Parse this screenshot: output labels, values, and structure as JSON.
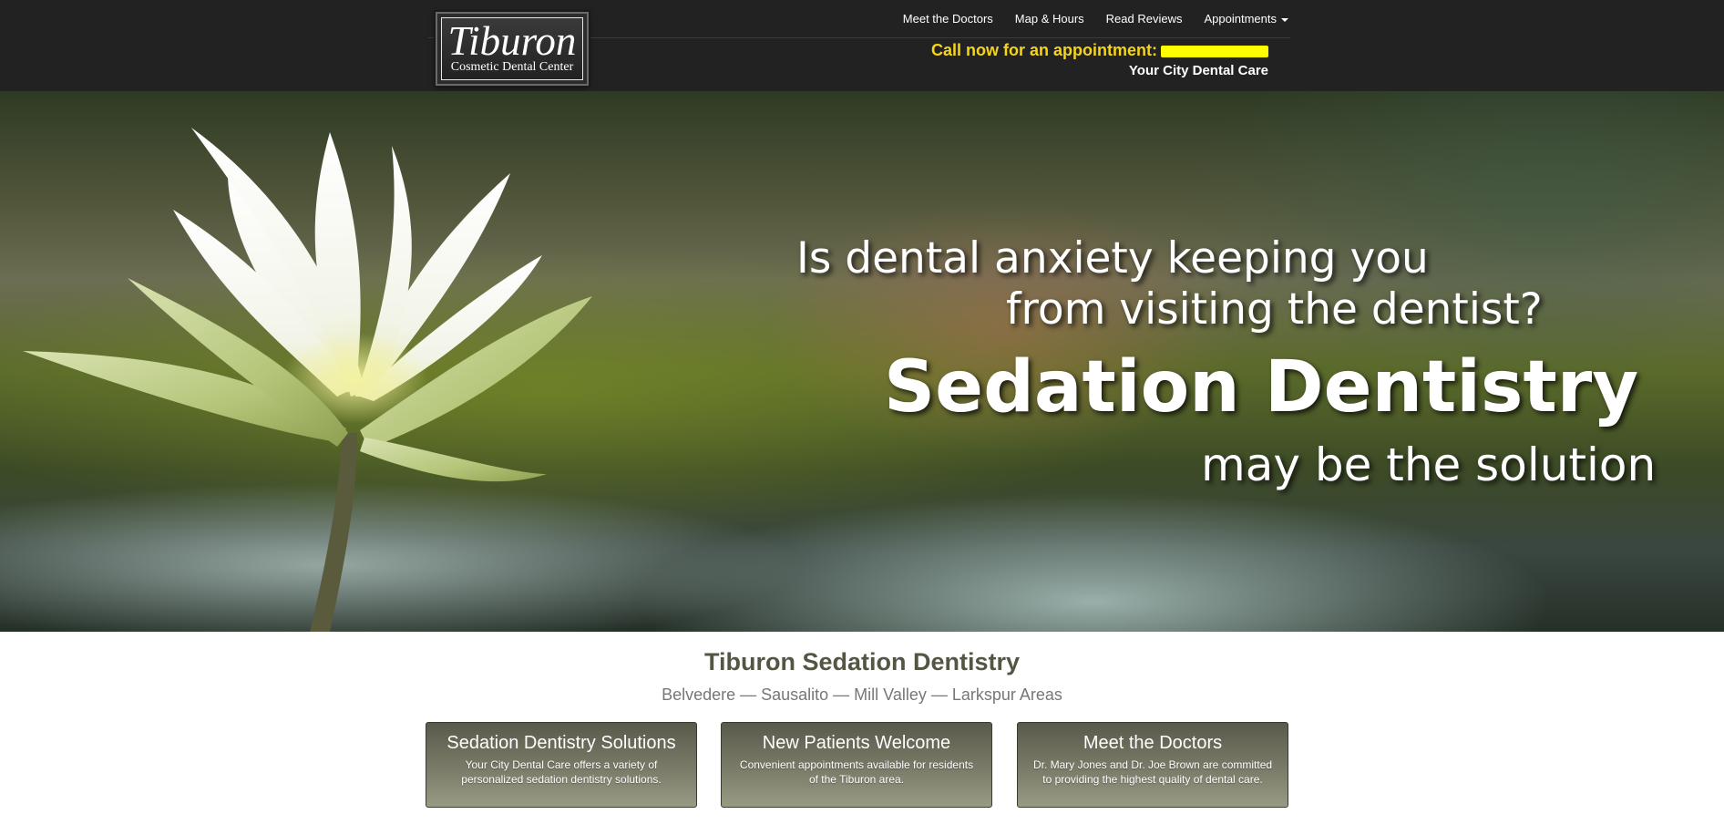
{
  "logo": {
    "name": "Tiburon",
    "subtitle": "Cosmetic Dental Center"
  },
  "nav": {
    "items": [
      {
        "label": "Meet the Doctors"
      },
      {
        "label": "Map & Hours"
      },
      {
        "label": "Read Reviews"
      },
      {
        "label": "Appointments"
      }
    ]
  },
  "call": {
    "label": "Call now for an appointment:"
  },
  "tagline": "Your City Dental Care",
  "hero": {
    "line1": "Is dental anxiety keeping you",
    "line2": "from visiting the dentist?",
    "line3": "Sedation Dentistry",
    "line4": "may be the solution"
  },
  "main": {
    "title": "Tiburon Sedation Dentistry",
    "areas": "Belvedere — Sausalito — Mill Valley — Larkspur Areas",
    "cards": [
      {
        "title": "Sedation Dentistry Solutions",
        "text": "Your City Dental Care offers a variety of personalized sedation dentistry solutions."
      },
      {
        "title": "New Patients Welcome",
        "text": "Convenient appointments available for residents of the Tiburon area."
      },
      {
        "title": "Meet the Doctors",
        "text": "Dr. Mary Jones and Dr. Joe Brown are committed to providing the highest quality of dental care."
      }
    ]
  },
  "colors": {
    "header_bg": "#222222",
    "call_accent": "#f5d41a",
    "phone_redaction": "#ffff00",
    "title_text": "#555544",
    "card_bg": "#7a7b68"
  },
  "icons": {
    "appointments_dropdown": "caret-down-icon",
    "hero_image": "water-lily-image"
  }
}
